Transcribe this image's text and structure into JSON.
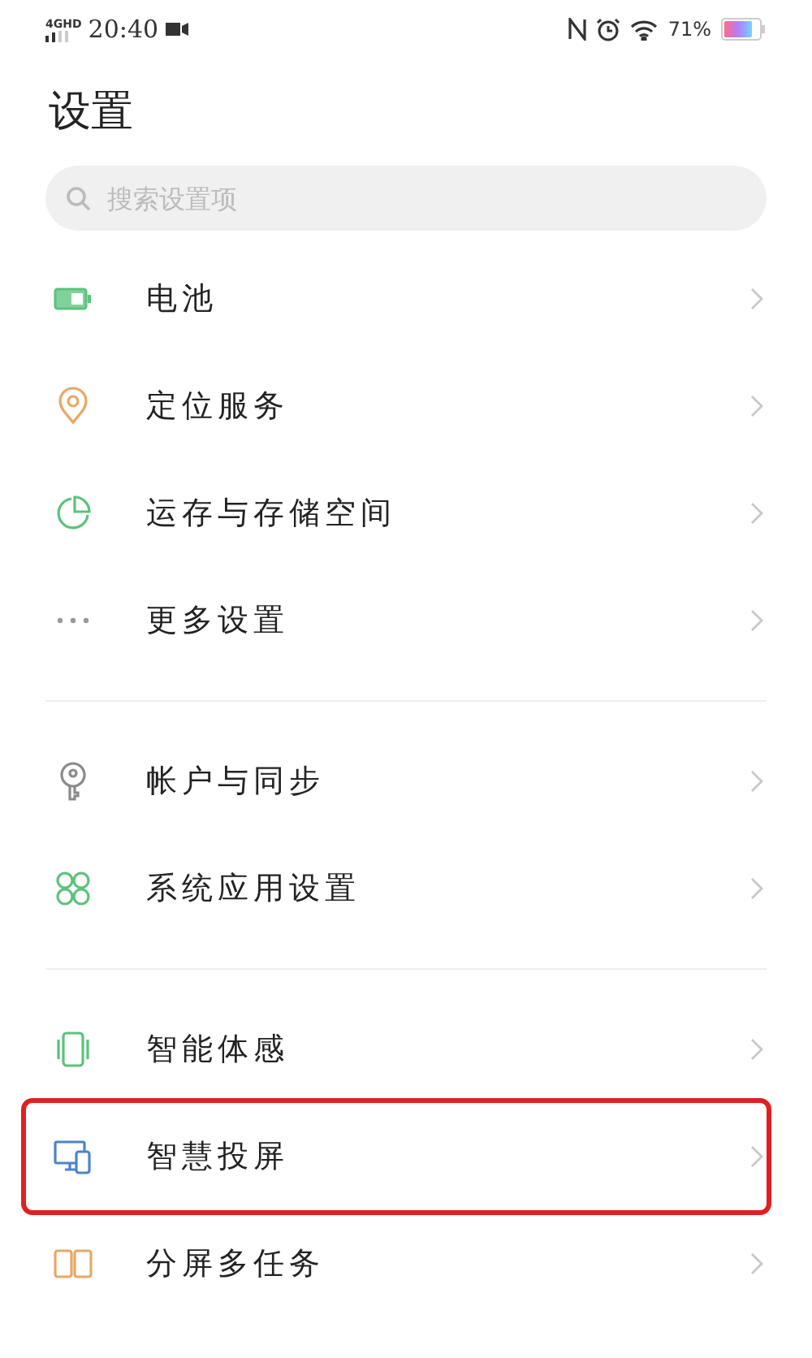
{
  "status_bar": {
    "network": "4GHD",
    "time": "20:40",
    "battery": "71%"
  },
  "title": "设置",
  "search": {
    "placeholder": "搜索设置项"
  },
  "groups": [
    {
      "items": [
        {
          "kind": "battery",
          "label": "电池",
          "highlighted": false
        },
        {
          "kind": "location",
          "label": "定位服务",
          "highlighted": false
        },
        {
          "kind": "storage",
          "label": "运存与存储空间",
          "highlighted": false
        },
        {
          "kind": "more",
          "label": "更多设置",
          "highlighted": false
        }
      ]
    },
    {
      "items": [
        {
          "kind": "key",
          "label": "帐户与同步",
          "highlighted": false
        },
        {
          "kind": "apps",
          "label": "系统应用设置",
          "highlighted": false
        }
      ]
    },
    {
      "items": [
        {
          "kind": "motion",
          "label": "智能体感",
          "highlighted": false
        },
        {
          "kind": "cast",
          "label": "智慧投屏",
          "highlighted": true
        },
        {
          "kind": "split",
          "label": "分屏多任务",
          "highlighted": false
        }
      ]
    }
  ]
}
